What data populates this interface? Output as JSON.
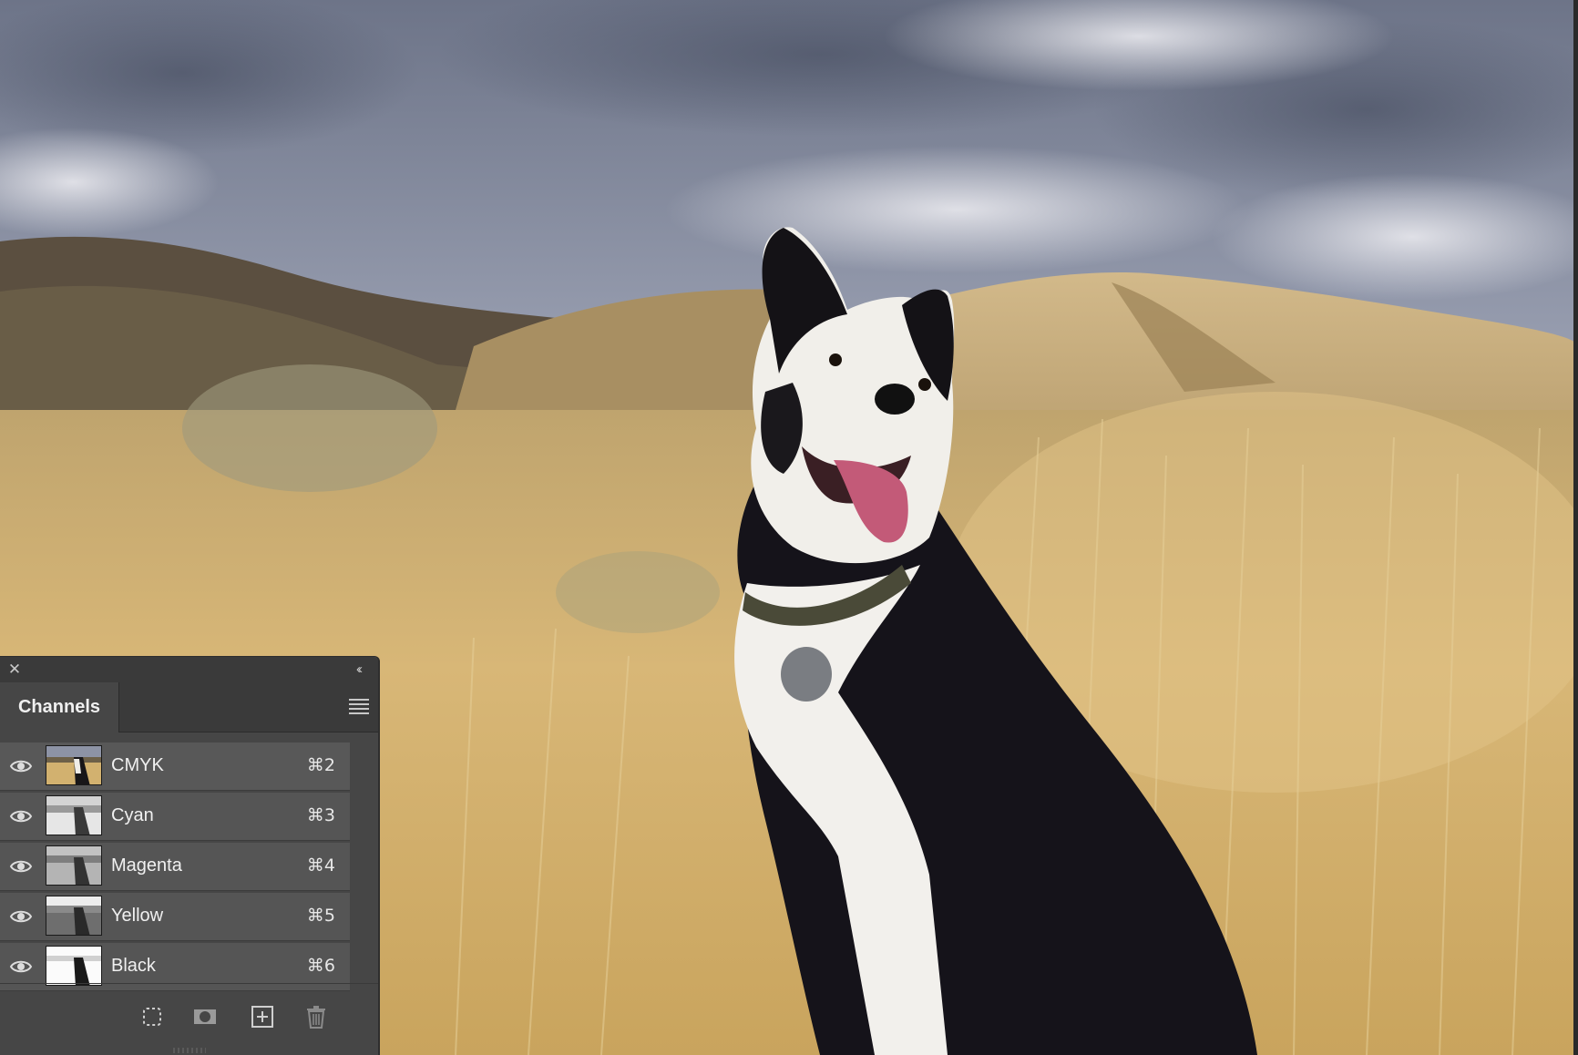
{
  "panel": {
    "close_icon": "close-icon",
    "collapse_icon": "double-chevron-left-icon",
    "tab_label": "Channels",
    "menu_icon": "hamburger-menu-icon",
    "channels": [
      {
        "name": "CMYK",
        "shortcut": "⌘2",
        "visible": true,
        "thumb": "color"
      },
      {
        "name": "Cyan",
        "shortcut": "⌘3",
        "visible": true,
        "thumb": "gray-light"
      },
      {
        "name": "Magenta",
        "shortcut": "⌘4",
        "visible": true,
        "thumb": "gray-mid"
      },
      {
        "name": "Yellow",
        "shortcut": "⌘5",
        "visible": true,
        "thumb": "gray-dark"
      },
      {
        "name": "Black",
        "shortcut": "⌘6",
        "visible": true,
        "thumb": "white"
      }
    ],
    "bottom_tools": [
      {
        "name": "load-channel-as-selection",
        "icon": "dotted-selection-icon"
      },
      {
        "name": "save-selection-as-channel",
        "icon": "mask-icon"
      },
      {
        "name": "create-new-channel",
        "icon": "plus-square-icon"
      },
      {
        "name": "delete-channel",
        "icon": "trash-icon"
      }
    ]
  },
  "document": {
    "image": "photo of black-and-white dog sitting in golden grass field with hills and cloudy sky"
  },
  "colors": {
    "panel_bg": "#464646",
    "row_bg": "#555555",
    "titlebar_bg": "#3a3a3a"
  }
}
